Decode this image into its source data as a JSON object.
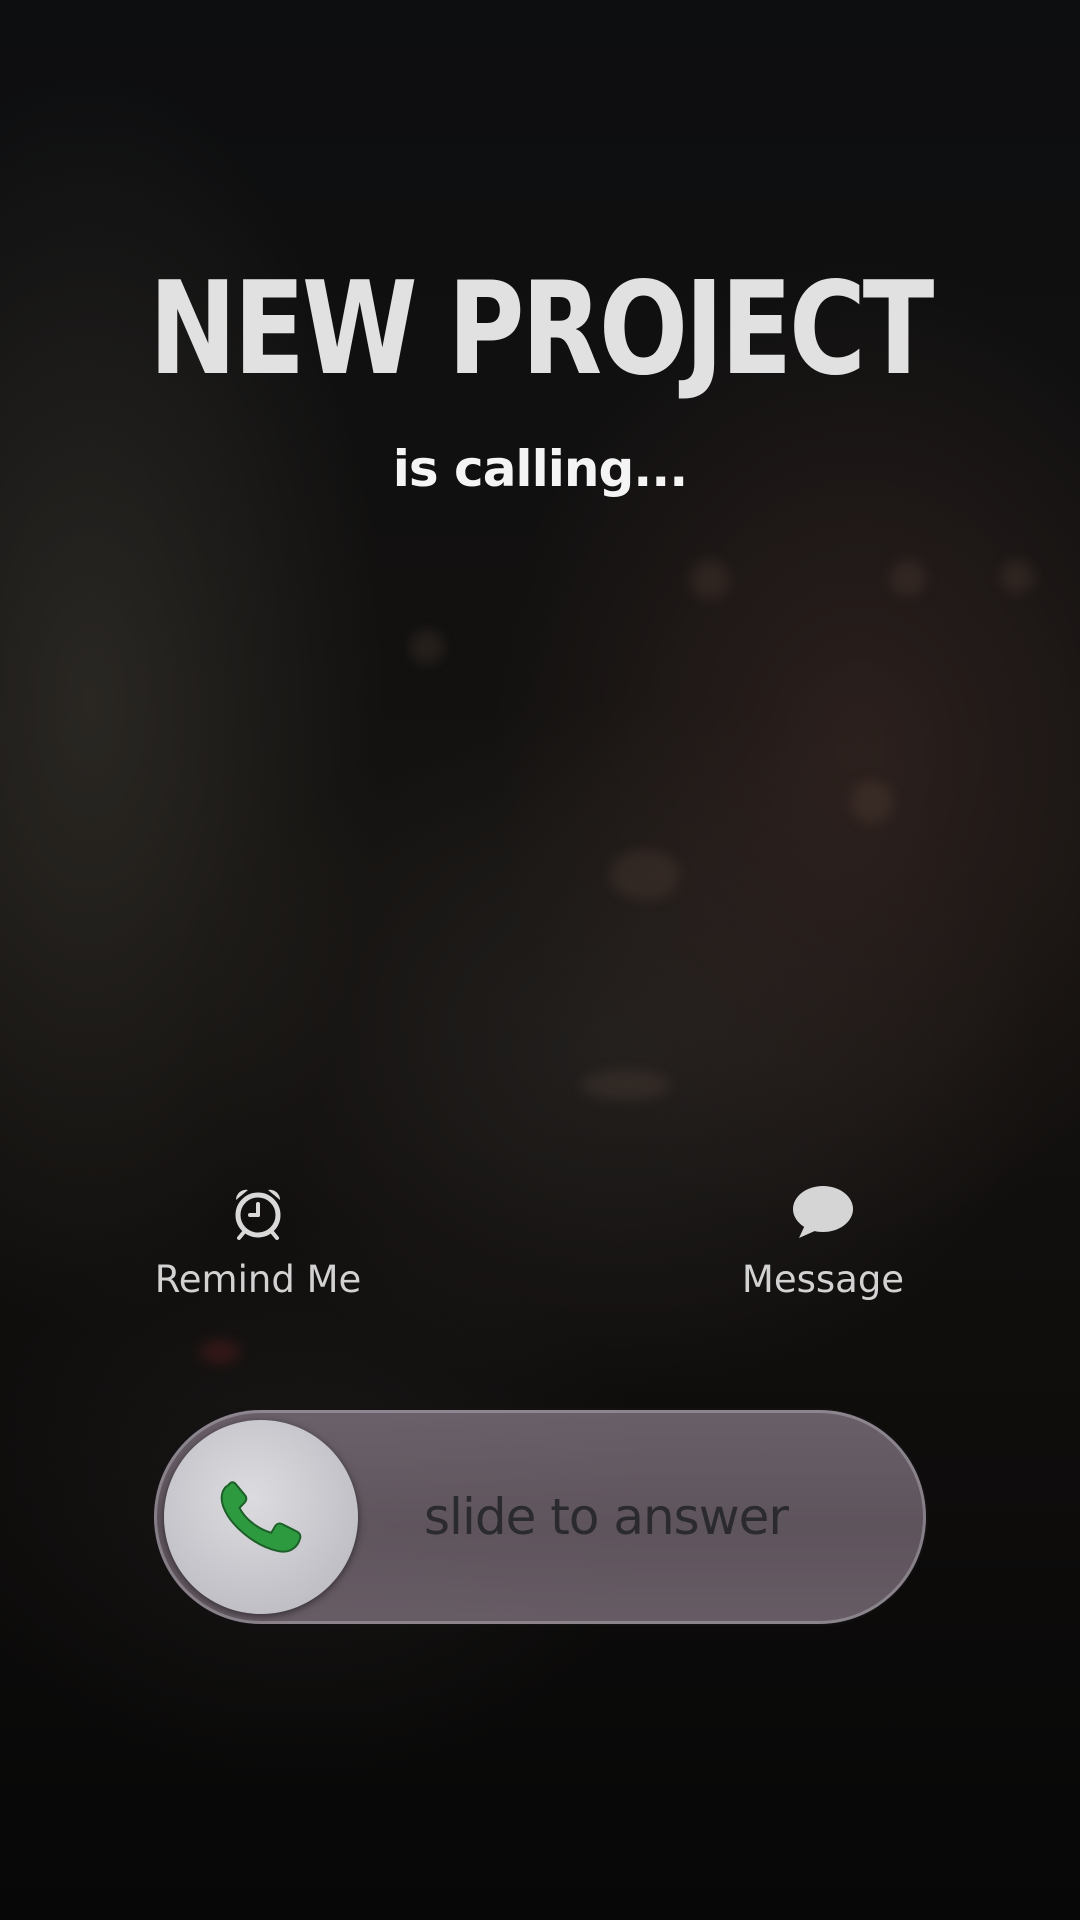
{
  "caller": {
    "name": "NEW PROJECT",
    "status": "is calling..."
  },
  "actions": {
    "remind_label": "Remind Me",
    "message_label": "Message"
  },
  "slider": {
    "label": "slide to answer"
  },
  "icons": {
    "remind": "alarm-clock-icon",
    "message": "speech-bubble-icon",
    "answer": "phone-icon"
  },
  "colors": {
    "phone_icon": "#2a8a3a",
    "text_primary": "#e1e1e1",
    "slider_track": "#766a74",
    "knob": "#c8c8cd"
  }
}
